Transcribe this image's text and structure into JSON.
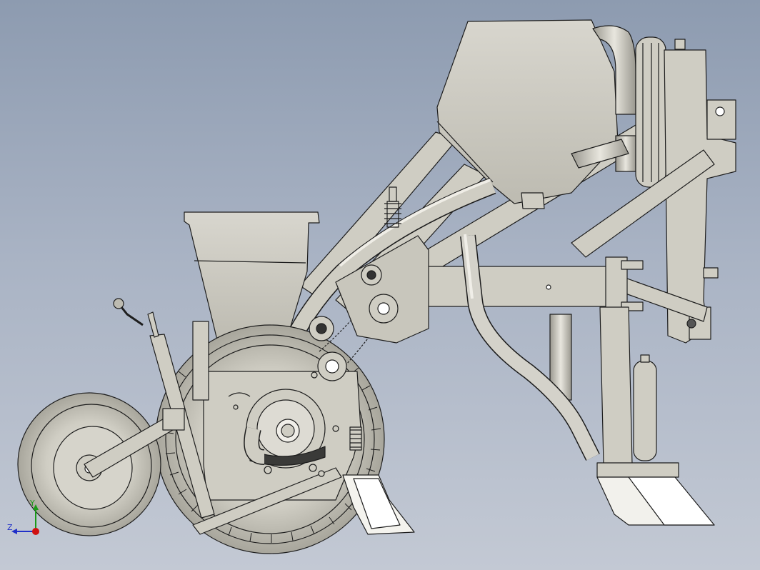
{
  "viewport": {
    "background_top": "#8d9bb0",
    "background_bottom": "#c3c9d4",
    "part_fill": "#cfcdc3",
    "part_stroke": "#1e1e1e"
  },
  "model": {
    "description_icon": "seeder-planter-assembly-icon"
  },
  "triad": {
    "y_label": "Y",
    "z_label": "Z",
    "y_color": "#1a9a1a",
    "z_color": "#2030c8",
    "x_color": "#d01010"
  }
}
